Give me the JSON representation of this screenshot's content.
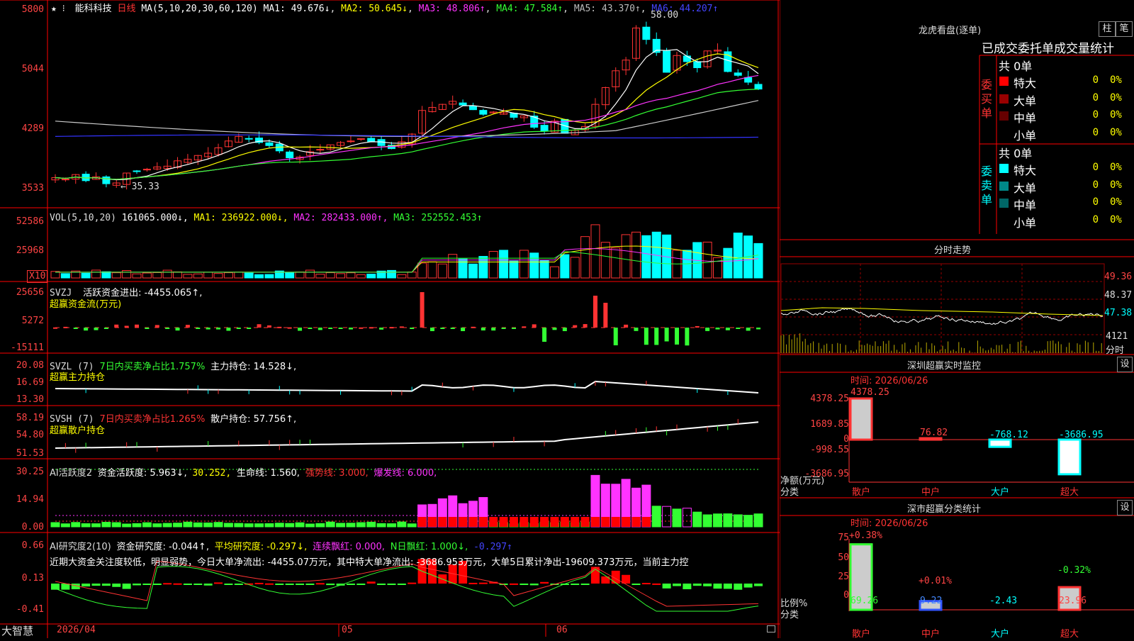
{
  "app": {
    "brand": "大智慧"
  },
  "colors": {
    "up": "#ff3333",
    "down": "#00ffff",
    "grid": "#ff0000",
    "ma1": "#ffffff",
    "ma2": "#ffff00",
    "ma3": "#ff33ff",
    "ma4": "#33ff33",
    "ma5": "#999999",
    "ma6": "#3333ff"
  },
  "main": {
    "star": "★ ⁝",
    "stock_name": "能科科技",
    "period": "日线",
    "ma_title": "MA(5,10,20,30,60,120)",
    "ma1": "MA1: 49.676↓",
    "ma2": "MA2: 50.645↓",
    "ma3": "MA3: 48.806↑",
    "ma4": "MA4: 47.584↑",
    "ma5": "MA5: 43.370↑",
    "ma6": "MA6: 44.207↑",
    "y_ticks": [
      "5800",
      "5044",
      "4289",
      "3533"
    ],
    "high_label": "58.00",
    "low_label": "← 35.33"
  },
  "vol": {
    "title": "VOL(5,10,20)",
    "value": "161065.000↓,",
    "ma1": "MA1: 236922.000↓,",
    "ma2": "MA2: 282433.000↑,",
    "ma3": "MA3: 252552.453↑",
    "y_ticks": [
      "52586",
      "25968"
    ],
    "unit": "X10"
  },
  "svzj": {
    "title": "SVZJ",
    "desc": "活跃资金进出: -4455.065↑,",
    "subtitle": "超赢资金流(万元)",
    "y_ticks": [
      "25656",
      "5272",
      "-15111"
    ]
  },
  "svzl": {
    "title": "SVZL (7)",
    "desc": "7日内买卖净占比1.757%",
    "pos": "主力持仓: 14.528↓,",
    "subtitle": "超赢主力持仓",
    "y_ticks": [
      "20.08",
      "16.69",
      "13.30"
    ]
  },
  "svsh": {
    "title": "SVSH (7)",
    "desc": "7日内买卖净占比1.265%",
    "pos": "散户持仓: 57.756↑,",
    "subtitle": "超赢散户持仓",
    "y_ticks": [
      "58.19",
      "54.80",
      "51.53"
    ]
  },
  "ai1": {
    "title": "AI活跃度2",
    "a": "资金活跃度: 5.963↓,",
    "b": "30.252,",
    "c": "生命线: 1.560,",
    "d": "强势线: 3.000,",
    "e": "爆发线: 6.000,",
    "y_ticks": [
      "30.25",
      "14.94",
      "0.00"
    ]
  },
  "ai2": {
    "title": "AI研究度2(10)",
    "a": "资金研究度: -0.044↑,",
    "b": "平均研究度: -0.297↓,",
    "c": "连续飘红: 0.000,",
    "d": "N日飘红: 1.000↓,",
    "e": "-0.297↑",
    "note": "近期大资金关注度较低，明显弱势，今日大单净流出: -4455.07万元，其中特大单净流出: -3686.953万元，大单5日累计净出-19609.373万元，当前主力控",
    "y_ticks": [
      "0.66",
      "0.13",
      "-0.41"
    ]
  },
  "x_labels": [
    "2026/04",
    "05",
    "06"
  ],
  "right": {
    "lhb_title": "龙虎看盘(逐单)",
    "btn_zhu": "柱",
    "btn_bi": "笔",
    "stat_title": "已成交委托单成交量统计",
    "buy_side": "委买单",
    "sell_side": "委卖单",
    "buy_total": "共 0单",
    "sell_total": "共 0单",
    "buy_rows": [
      {
        "name": "特大",
        "val": "0",
        "pct": "0%",
        "color": "#ff0000"
      },
      {
        "name": "大单",
        "val": "0",
        "pct": "0%",
        "color": "#990000"
      },
      {
        "name": "中单",
        "val": "0",
        "pct": "0%",
        "color": "#660000"
      },
      {
        "name": "小单",
        "val": "0",
        "pct": "0%",
        "color": "#000000"
      }
    ],
    "sell_rows": [
      {
        "name": "特大",
        "val": "0",
        "pct": "0%",
        "color": "#00ffff"
      },
      {
        "name": "大单",
        "val": "0",
        "pct": "0%",
        "color": "#008888"
      },
      {
        "name": "中单",
        "val": "0",
        "pct": "0%",
        "color": "#006666"
      },
      {
        "name": "小单",
        "val": "0",
        "pct": "0%",
        "color": "#000000"
      }
    ],
    "fs_title": "分时走势",
    "fs_ticks": [
      "49.36",
      "48.37",
      "47.38"
    ],
    "fs_vol": "4121",
    "fs_unit": "分时",
    "sz_title": "深圳超赢实时监控",
    "set": "设",
    "sz_time": "时间: 2026/06/26",
    "sz_ticks": [
      "4378.25",
      "1689.85",
      "0",
      "-998.55",
      "-3686.95"
    ],
    "sz_axis_unit": "净额(万元)",
    "sz_axis_cat": "分类",
    "sz_bars": [
      {
        "cat": "散户",
        "label": "4378.25",
        "value": 4378.25
      },
      {
        "cat": "中户",
        "label": "76.82",
        "value": 76.82
      },
      {
        "cat": "大户",
        "label": "-768.12",
        "value": -768.12
      },
      {
        "cat": "超大",
        "label": "-3686.95",
        "value": -3686.95
      }
    ],
    "ss_title": "深市超赢分类统计",
    "ss_time": "时间: 2026/06/26",
    "ss_ticks": [
      "75",
      "50",
      "25",
      "0"
    ],
    "ss_axis_unit": "比例%",
    "ss_axis_cat": "分类",
    "ss_bars": [
      {
        "cat": "散户",
        "top": "+0.38%",
        "bottom": "69.26",
        "value": 69.26
      },
      {
        "cat": "中户",
        "top": "+0.01%",
        "bottom": "9.22",
        "value": 9.22
      },
      {
        "cat": "大户",
        "top": "",
        "bottom": "-2.43",
        "value": -2.43
      },
      {
        "cat": "超大",
        "top": "-0.32%",
        "bottom": "23.96",
        "value": 23.96
      }
    ]
  }
}
